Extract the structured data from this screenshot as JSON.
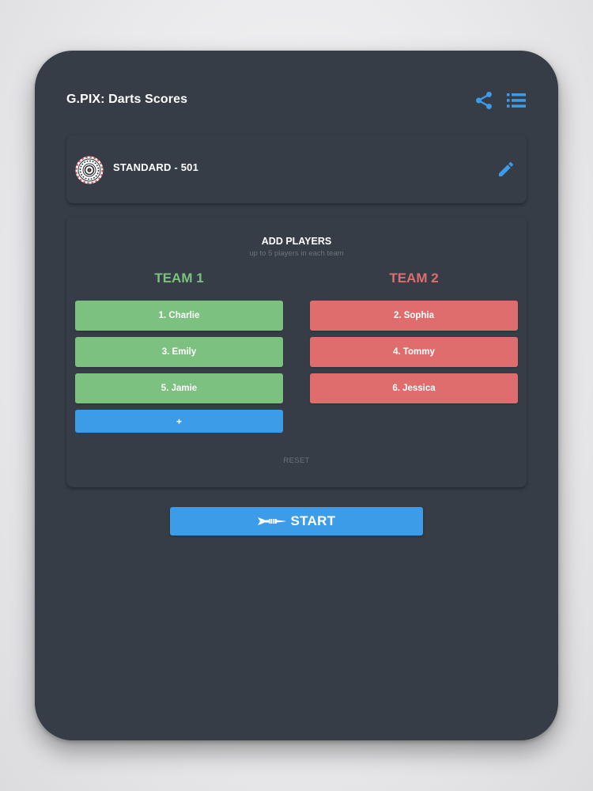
{
  "app": {
    "title": "G.PIX: Darts Scores"
  },
  "header": {
    "icons": [
      "share-icon",
      "list-menu-icon"
    ]
  },
  "game_mode": {
    "label": "STANDARD - 501",
    "icon": "dartboard-icon",
    "edit_icon": "pencil-icon"
  },
  "players": {
    "title": "ADD PLAYERS",
    "subtitle": "up to 5 players in each team",
    "team1": {
      "name": "TEAM 1",
      "color": "#7cc17f",
      "players": [
        "1. Charlie",
        "3. Emily",
        "5. Jamie"
      ],
      "add_label": "+"
    },
    "team2": {
      "name": "TEAM 2",
      "color": "#e06d6e",
      "players": [
        "2. Sophia",
        "4. Tommy",
        "6. Jessica"
      ]
    },
    "reset_label": "RESET"
  },
  "start": {
    "label": "START",
    "icon": "dart-icon"
  },
  "colors": {
    "background": "#363d46",
    "accent": "#3d9ce8",
    "team1": "#7cc17f",
    "team2": "#e06d6e"
  }
}
